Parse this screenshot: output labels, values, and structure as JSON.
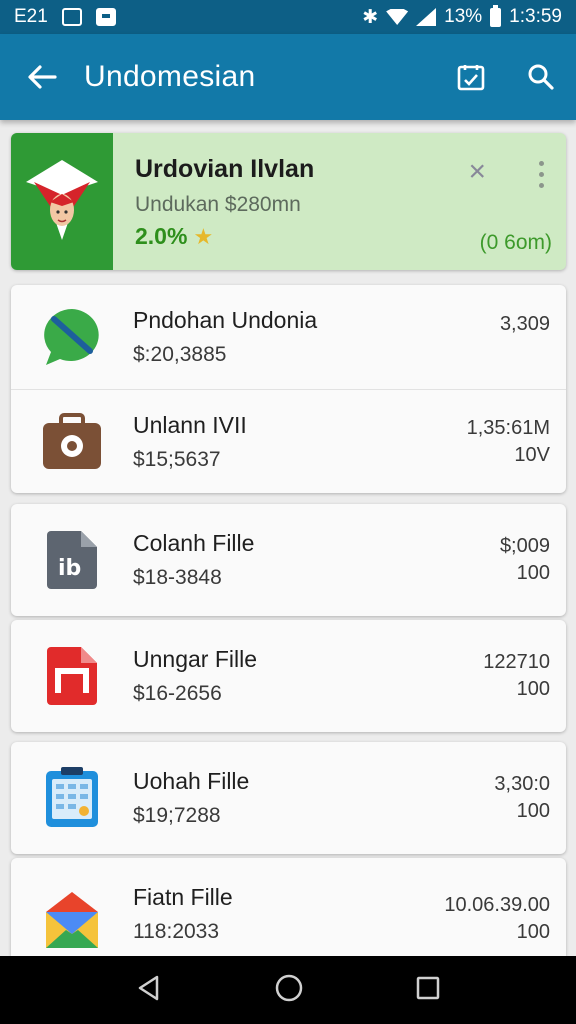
{
  "status_bar": {
    "carrier": "E21",
    "battery": "13%",
    "time": "1:3:59"
  },
  "app_bar": {
    "title": "Undomesian",
    "icons": [
      "back-arrow-icon",
      "checklist-icon",
      "search-icon"
    ]
  },
  "featured": {
    "title": "Urdovian Ilvlan",
    "subtitle": "Undukan $280mn",
    "rating": "2.0%",
    "right_value": "(0 6om)"
  },
  "items": [
    {
      "title": "Pndohan Undonia",
      "price": "$:20,3885",
      "right_top": "3,309",
      "right_bottom": "",
      "icon": "green-chat-icon"
    },
    {
      "title": "Unlann IVII",
      "price": "$15;5637",
      "right_top": "1,35:61M",
      "right_bottom": "10V",
      "icon": "brown-bag-icon"
    },
    {
      "title": "Colanh Fille",
      "price": "$18-3848",
      "right_top": "$;009",
      "right_bottom": "100",
      "icon": "gray-doc-icon"
    },
    {
      "title": "Unngar Fille",
      "price": "$16-2656",
      "right_top": "122710",
      "right_bottom": "100",
      "icon": "red-doc-icon"
    },
    {
      "title": "Uohah Fille",
      "price": "$19;7288",
      "right_top": "3,30:0",
      "right_bottom": "100",
      "icon": "blue-sheet-icon"
    },
    {
      "title": "Fiatn Fille",
      "price": "118:2033",
      "right_top": "10.06.39.00",
      "right_bottom": "100",
      "icon": "mail-envelope-icon"
    }
  ],
  "colors": {
    "status_bar": "#0d5f86",
    "app_bar": "#1279a8",
    "featured_bg": "#cfeac4",
    "accent_green": "#2e8f1c"
  }
}
